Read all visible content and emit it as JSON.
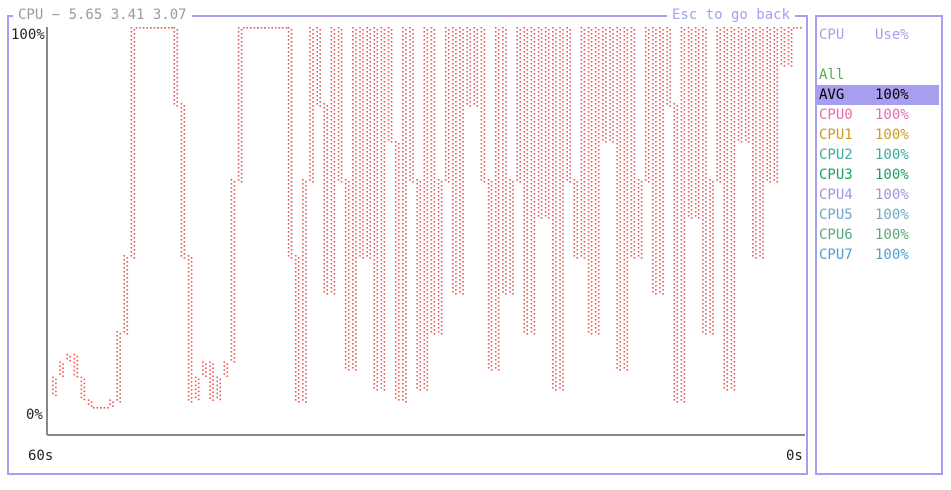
{
  "title": "CPU − 5.65 3.41 3.07",
  "hint": "Esc to go back",
  "y_max_label": "100%",
  "y_min_label": "0%",
  "x_left_label": "60s",
  "x_right_label": "0s",
  "legend": {
    "header_name": "CPU",
    "header_value": "Use%",
    "group_label": "All",
    "rows": [
      {
        "name": "AVG",
        "value": "100%",
        "color": "#000000",
        "selected": true
      },
      {
        "name": "CPU0",
        "value": "100%",
        "color": "#e86ab0",
        "selected": false
      },
      {
        "name": "CPU1",
        "value": "100%",
        "color": "#d49a17",
        "selected": false
      },
      {
        "name": "CPU2",
        "value": "100%",
        "color": "#3aaaa0",
        "selected": false
      },
      {
        "name": "CPU3",
        "value": "100%",
        "color": "#1aa060",
        "selected": false
      },
      {
        "name": "CPU4",
        "value": "100%",
        "color": "#a98ee8",
        "selected": false
      },
      {
        "name": "CPU5",
        "value": "100%",
        "color": "#6ea8c8",
        "selected": false
      },
      {
        "name": "CPU6",
        "value": "100%",
        "color": "#5aa878",
        "selected": false
      },
      {
        "name": "CPU7",
        "value": "100%",
        "color": "#4aa0d8",
        "selected": false
      }
    ]
  },
  "chart_data": {
    "type": "line",
    "series_color": "#ee5555",
    "ylim": [
      0,
      100
    ],
    "x_range_seconds": [
      60,
      0
    ],
    "series": [
      {
        "name": "AVG",
        "values": [
          3,
          8,
          12,
          14,
          8,
          2,
          0,
          0,
          0,
          2,
          20,
          40,
          100,
          100,
          100,
          100,
          100,
          100,
          80,
          40,
          2,
          8,
          12,
          2,
          8,
          12,
          60,
          100,
          100,
          100,
          100,
          100,
          100,
          100,
          40,
          2,
          60,
          100,
          80,
          30,
          100,
          60,
          10,
          100,
          40,
          100,
          5,
          100,
          70,
          2,
          100,
          60,
          5,
          100,
          20,
          60,
          100,
          30,
          100,
          80,
          100,
          60,
          10,
          100,
          30,
          60,
          100,
          20,
          100,
          50,
          100,
          5,
          100,
          60,
          40,
          100,
          20,
          100,
          70,
          100,
          10,
          100,
          40,
          60,
          100,
          30,
          100,
          80,
          2,
          100,
          50,
          100,
          20,
          60,
          100,
          5,
          100,
          70,
          100,
          40,
          100,
          60,
          100,
          90,
          100,
          100
        ]
      }
    ]
  }
}
